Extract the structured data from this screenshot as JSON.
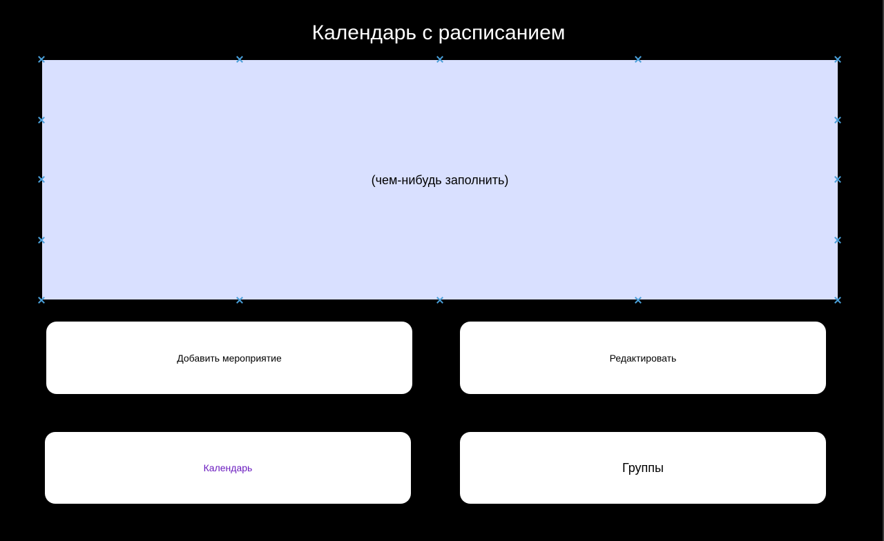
{
  "header": {
    "title": "Календарь с расписанием"
  },
  "placeholder": {
    "text": "(чем-нибудь заполнить)"
  },
  "buttons": {
    "add_event": "Добавить мероприятие",
    "edit": "Редактировать",
    "calendar": "Календарь",
    "groups": "Группы"
  },
  "colors": {
    "background": "#000000",
    "panel": "#d9e0ff",
    "handle": "#4a9fd8",
    "calendar_label": "#6a1bbf",
    "card": "#ffffff"
  }
}
